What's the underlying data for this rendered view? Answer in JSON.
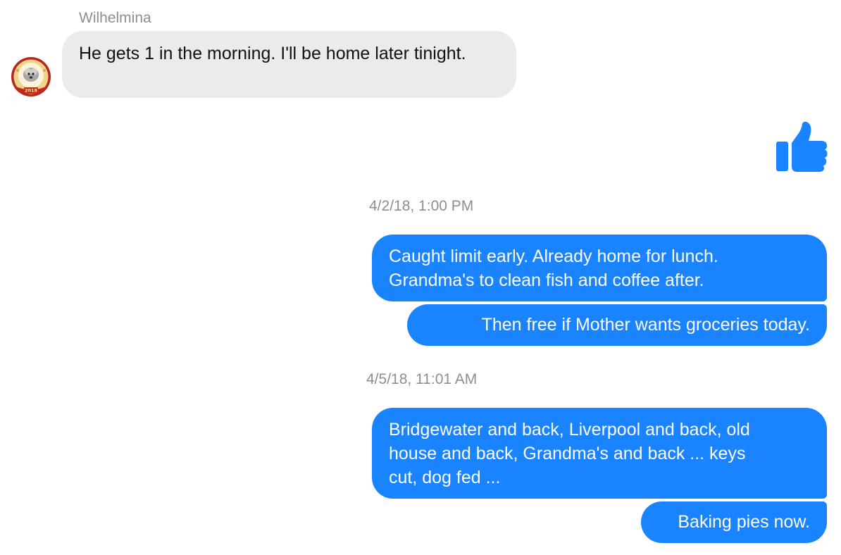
{
  "conversation": {
    "incoming": {
      "sender_name": "Wilhelmina",
      "avatar_label": "2018",
      "message": "He gets 1 in the morning. I'll be home later tinight."
    },
    "reaction": {
      "icon": "thumbs-up-icon",
      "color": "#1a83ff"
    },
    "groups": [
      {
        "timestamp": "4/2/18, 1:00 PM",
        "messages": [
          "Caught limit early.  Already home for lunch.\nGrandma's to clean fish and coffee after.",
          "Then free if Mother wants groceries today."
        ]
      },
      {
        "timestamp": "4/5/18, 11:01 AM",
        "messages": [
          "Bridgewater and back, Liverpool and back, old\nhouse and back, Grandma's and back ... keys\ncut, dog fed ...",
          "Baking pies now."
        ]
      }
    ]
  },
  "colors": {
    "outgoing_bubble": "#1a83ff",
    "incoming_bubble": "#ebebeb",
    "meta_text": "#8e8e8e"
  }
}
